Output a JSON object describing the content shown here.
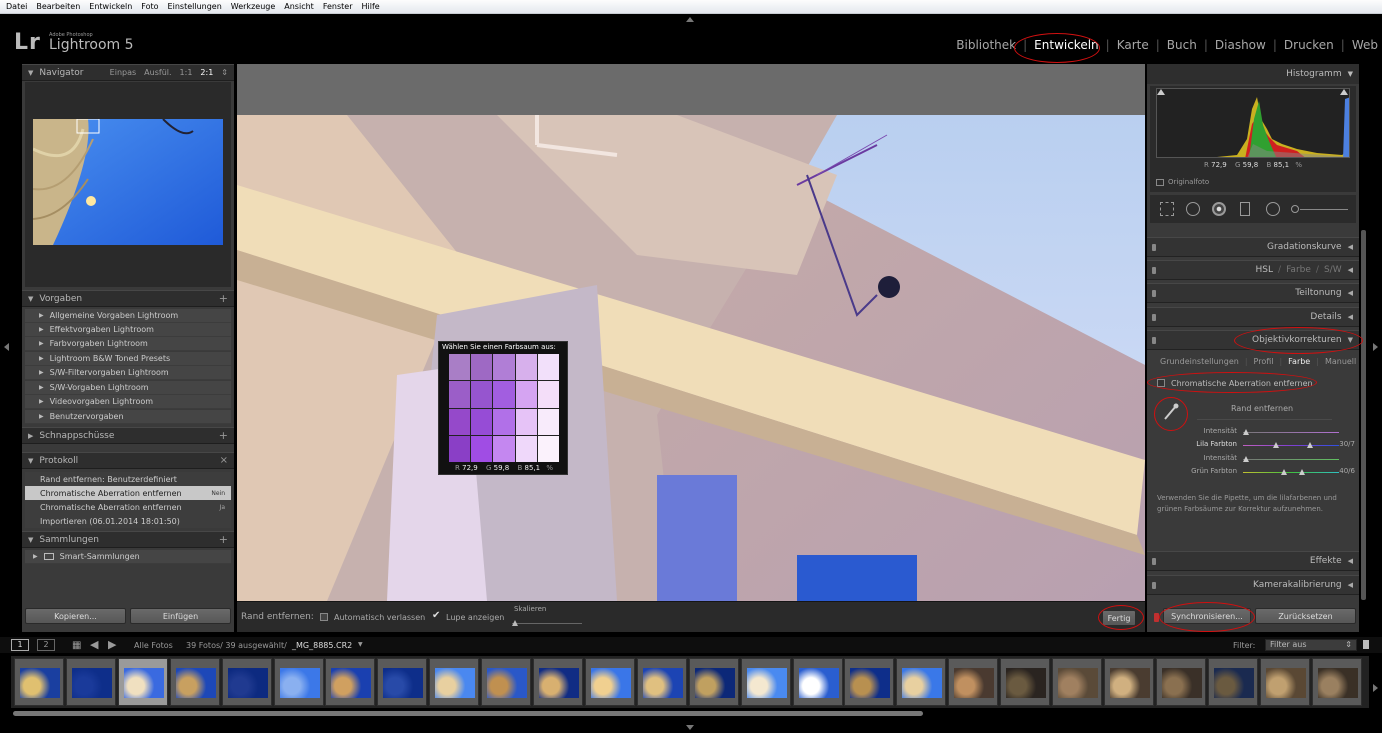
{
  "menubar": [
    "Datei",
    "Bearbeiten",
    "Entwickeln",
    "Foto",
    "Einstellungen",
    "Werkzeuge",
    "Ansicht",
    "Fenster",
    "Hilfe"
  ],
  "logo": {
    "mark": "Lr",
    "small": "Adobe Photoshop",
    "big": "Lightroom 5"
  },
  "modules": [
    "Bibliothek",
    "Entwickeln",
    "Karte",
    "Buch",
    "Diashow",
    "Drucken",
    "Web"
  ],
  "active_module": "Entwickeln",
  "left": {
    "navigator": {
      "title": "Navigator",
      "options": [
        "Einpas",
        "Ausfül.",
        "1:1",
        "2:1"
      ]
    },
    "presets": {
      "title": "Vorgaben",
      "items": [
        "Allgemeine Vorgaben Lightroom",
        "Effektvorgaben Lightroom",
        "Farbvorgaben Lightroom",
        "Lightroom B&W Toned Presets",
        "S/W-Filtervorgaben Lightroom",
        "S/W-Vorgaben Lightroom",
        "Videovorgaben Lightroom",
        "Benutzervorgaben"
      ]
    },
    "snapshots": {
      "title": "Schnappschüsse"
    },
    "history": {
      "title": "Protokoll",
      "items": [
        {
          "label": "Rand entfernen: Benutzerdefiniert",
          "value": ""
        },
        {
          "label": "Chromatische Aberration entfernen",
          "value": "Nein"
        },
        {
          "label": "Chromatische Aberration entfernen",
          "value": "Ja"
        },
        {
          "label": "Importieren (06.01.2014 18:01:50)",
          "value": ""
        }
      ]
    },
    "collections": {
      "title": "Sammlungen",
      "items": [
        "Smart-Sammlungen"
      ]
    },
    "copy_button": "Kopieren...",
    "paste_button": "Einfügen"
  },
  "popup": {
    "title": "Wählen Sie einen Farbsaum aus:",
    "r_label": "R",
    "r": "72,9",
    "g_label": "G",
    "g": "59,8",
    "b_label": "B",
    "b": "85,1",
    "pct": "%",
    "colors": [
      [
        "#a97ec6",
        "#9e69c4",
        "#b07ed6",
        "#d7b0ec",
        "#f2e0fa"
      ],
      [
        "#9b5ec8",
        "#9655cf",
        "#a25ee0",
        "#d5a4f2",
        "#f4def9"
      ],
      [
        "#9549ca",
        "#964cd6",
        "#b170e8",
        "#e6c3f7",
        "#f8ebfb"
      ],
      [
        "#8a3fc6",
        "#a04de4",
        "#c487f0",
        "#efd8fa",
        "#fbf2fc"
      ]
    ]
  },
  "toolbar": {
    "label": "Rand entfernen:",
    "auto_leave": "Automatisch verlassen",
    "show_loupe": "Lupe anzeigen",
    "scale": "Skalieren",
    "done": "Fertig"
  },
  "right": {
    "histogram": {
      "title": "Histogramm",
      "r_label": "R",
      "r": "72,9",
      "g_label": "G",
      "g": "59,8",
      "b_label": "B",
      "b": "85,1",
      "pct": "%",
      "original": "Originalfoto"
    },
    "panels": {
      "tone_curve": "Gradationskurve",
      "hsl": "HSL",
      "color": "Farbe",
      "bw": "S/W",
      "split": "Teiltonung",
      "details": "Details",
      "lens": "Objektivkorrekturen",
      "effects": "Effekte",
      "calibration": "Kamerakalibrierung"
    },
    "lens_tabs": [
      "Grundeinstellungen",
      "Profil",
      "Farbe",
      "Manuell"
    ],
    "active_tab": "Farbe",
    "remove_ca": "Chromatische Aberration entfernen",
    "defringe": "Rand entfernen",
    "sliders": [
      {
        "label": "Intensität",
        "value": "",
        "pos": 0.0
      },
      {
        "label": "Lila Farbton",
        "value": "30/7",
        "pos": 0.32
      },
      {
        "label": "Intensität",
        "value": "",
        "pos": 0.0
      },
      {
        "label": "Grün Farbton",
        "value": "40/6",
        "pos": 0.4
      }
    ],
    "help": "Verwenden Sie die Pipette, um die lilafarbenen und grünen Farbsäume zur Korrektur aufzunehmen.",
    "sync_button": "Synchronisieren...",
    "reset_button": "Zurücksetzen"
  },
  "filmstrip": {
    "page1": "1",
    "page2": "2",
    "source": "Alle Fotos",
    "count": "39 Fotos/ 39 ausgewählt/",
    "file": "_MG_8885.CR2",
    "filter_label": "Filter:",
    "filter_value": "Filter aus"
  },
  "colors": {
    "accent_circle": "#d01010",
    "panel": "#3a3a3a",
    "sky": "#2f6fe0"
  }
}
